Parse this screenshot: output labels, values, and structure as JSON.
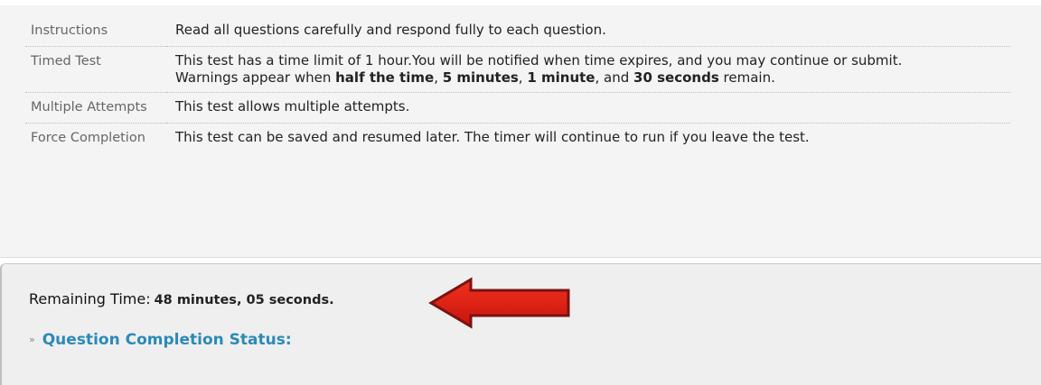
{
  "instructions": {
    "rows": [
      {
        "label": "Instructions",
        "text": "Read all questions carefully and respond fully to each question."
      },
      {
        "label": "Timed Test",
        "line1": "This test has a time limit of 1 hour.You will be notified when time expires, and you may continue or submit.",
        "warn_prefix": "Warnings appear when ",
        "warn_b1": "half the time",
        "warn_s1": ", ",
        "warn_b2": "5 minutes",
        "warn_s2": ", ",
        "warn_b3": "1 minute",
        "warn_s3": ", and ",
        "warn_b4": "30 seconds",
        "warn_suffix": " remain."
      },
      {
        "label": "Multiple Attempts",
        "text": "This test allows multiple attempts."
      },
      {
        "label": "Force Completion",
        "text": "This test can be saved and resumed later. The timer will continue to run if you leave the test."
      }
    ]
  },
  "status": {
    "remaining_label": "Remaining Time:",
    "remaining_value": "48 minutes, 05 seconds.",
    "completion_label": "Question Completion Status:"
  },
  "colors": {
    "arrow_fill": "#e8251b",
    "arrow_stroke": "#7a1212",
    "link": "#2a8ab8"
  },
  "icons": {
    "arrow": "red-left-arrow-icon",
    "toggle": "double-chevron-down-icon"
  }
}
